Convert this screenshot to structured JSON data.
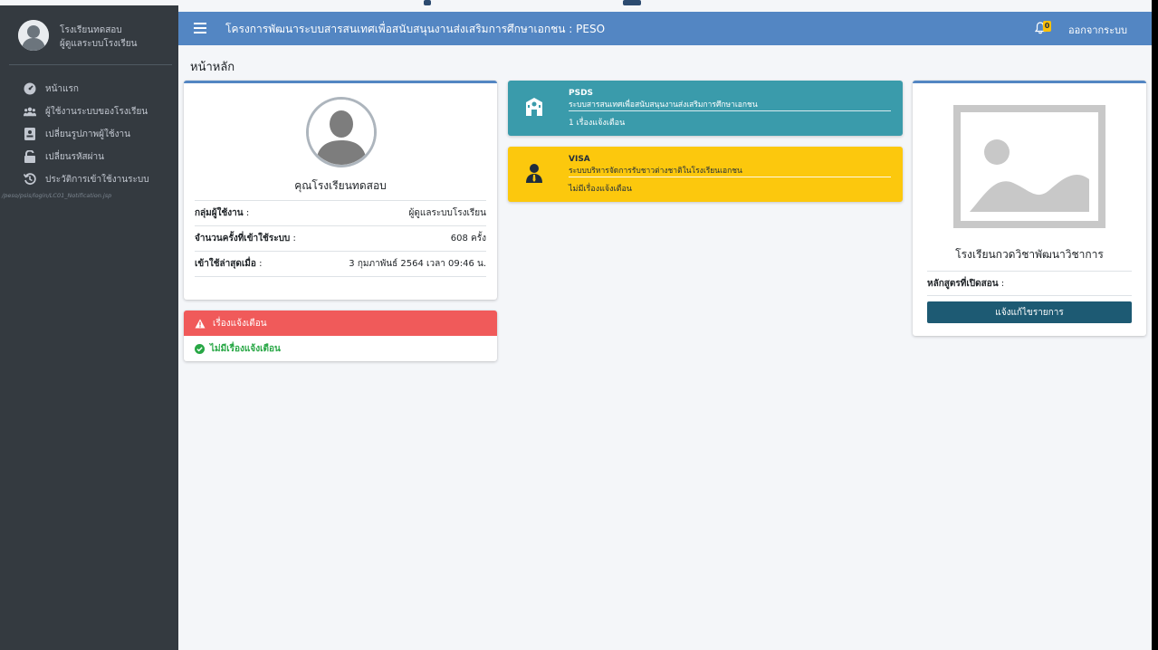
{
  "sidebar": {
    "user_name": "โรงเรียนทดสอบ",
    "user_role": "ผู้ดูแลระบบโรงเรียน",
    "items": [
      {
        "label": "หน้าแรก",
        "icon": "dashboard-icon"
      },
      {
        "label": "ผู้ใช้งานระบบของโรงเรียน",
        "icon": "users-icon"
      },
      {
        "label": "เปลี่ยนรูปภาพผู้ใช้งาน",
        "icon": "portrait-icon"
      },
      {
        "label": "เปลี่ยนรหัสผ่าน",
        "icon": "unlock-icon"
      },
      {
        "label": "ประวัติการเข้าใช้งานระบบ",
        "icon": "history-icon"
      }
    ],
    "path": "/peso/psis/login/LC01_Notification.jsp"
  },
  "topbar": {
    "title": "โครงการพัฒนาระบบสารสนเทศเพื่อสนับสนุนงานส่งเสริมการศึกษาเอกชน : PESO",
    "notification_count": "0",
    "logout_label": "ออกจากระบบ"
  },
  "page": {
    "title": "หน้าหลัก"
  },
  "profile": {
    "name": "คุณโรงเรียนทดสอบ",
    "rows": [
      {
        "label": "กลุ่มผู้ใช้งาน",
        "value": "ผู้ดูแลระบบโรงเรียน"
      },
      {
        "label": "จำนวนครั้งที่เข้าใช้ระบบ",
        "value": "608 ครั้ง"
      },
      {
        "label": "เข้าใช้ล่าสุดเมื่อ",
        "value": "3 กุมภาพันธ์ 2564 เวลา 09:46 น."
      }
    ]
  },
  "alerts": {
    "header": "เรื่องแจ้งเตือน",
    "body": "ไม่มีเรื่องแจ้งเตือน"
  },
  "systems": [
    {
      "code": "PSDS",
      "name": "ระบบสารสนเทศเพื่อสนับสนุนงานส่งเสริมการศึกษาเอกชน",
      "notice": "1 เรื่องแจ้งเตือน",
      "color": "#3a9bab"
    },
    {
      "code": "VISA",
      "name": "ระบบบริหารจัดการรับชาวต่างชาติในโรงเรียนเอกชน",
      "notice": "ไม่มีเรื่องแจ้งเตือน",
      "color": "#fcc80d"
    }
  ],
  "school": {
    "name": "โรงเรียนกวดวิชาพัฒนาวิชาการ",
    "course_label": "หลักสูตรที่เปิดสอน",
    "course_value": "",
    "edit_label": "แจ้งแก้ไขรายการ"
  },
  "colors": {
    "topbar": "#5386c3",
    "sidebar": "#343a40",
    "alert": "#f05a5a",
    "psds": "#3a9bab",
    "visa": "#fcc80d",
    "edit_button": "#1d5a73"
  }
}
